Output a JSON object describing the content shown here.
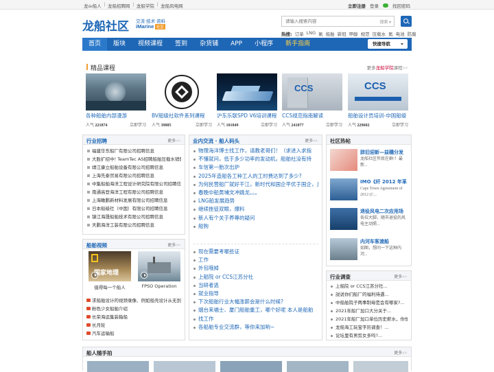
{
  "topbar": {
    "links": [
      "龙de船人",
      "龙船招聘网",
      "龙船学院",
      "龙船风电网"
    ],
    "login_register": "立即注册",
    "login": "登录",
    "find_password": "找回密码"
  },
  "logo": {
    "cn": "龙船社区",
    "tagline": "交流·技术·资料",
    "en": "iMarine",
    "app": "社区"
  },
  "search": {
    "placeholder": "请输入搜索内容",
    "type": "搜索",
    "hot_label": "热搜:",
    "hot": [
      "订单",
      "LNG",
      "氧",
      "船舶",
      "新冠",
      "甲醇",
      "规范",
      "压载水",
      "氮",
      "电池",
      "防腐"
    ]
  },
  "nav": {
    "items": [
      "首页",
      "版块",
      "视频课程",
      "签到",
      "杂货铺",
      "APP",
      "小程序",
      "新手指南"
    ],
    "quick": "快捷导航"
  },
  "courses": {
    "title": "精品课程",
    "more_prefix": "更多",
    "more_link": "龙船学院",
    "more_suffix": "课程>>",
    "pop_label": "人气",
    "learn_label": "立即学习",
    "items": [
      {
        "title": "各种船舶内部漫游",
        "pop": "221874"
      },
      {
        "title": "BV船级社软件系列课程",
        "pop": "39885"
      },
      {
        "title": "沪东乐联SPD V6培训课程",
        "pop": "101849"
      },
      {
        "title": "CCS规范指南解读",
        "pop": "241077"
      },
      {
        "title": "船舶设计员培训-中国船级",
        "pop": "229602"
      }
    ]
  },
  "jobs": {
    "title": "行业招聘",
    "more": "更多>>",
    "items": [
      "福建华东船厂有限公司招聘信息",
      "大胜扩招中! TeamTec AS招聘船舶压载水销售",
      "靖江康立船舶设备有限公司招聘信息",
      "上海先泰贸易有限公司招聘信息",
      "中集船舶海洋工程设计研究院有限公司招聘信息",
      "南通高登海洋工程有限公司招聘信息",
      "上海瞰鹏新材料发展有限公司招聘信息",
      "日本船级社（中国）有限公司招聘信息",
      "镇江海晟船舶技术有限公司招聘信息",
      "天鹏海洋工装有限公司招聘信息"
    ]
  },
  "videos": {
    "title": "船舶视频",
    "more": "更多>>",
    "thumbs": [
      {
        "caption": "值得每一个船人"
      },
      {
        "caption": "FPSO Operation"
      }
    ],
    "thumb_text": "国家地理",
    "items": [
      "求船舶设计的视频录像、例如船壳设计从无到",
      "粉色少女船舶介绍",
      "长荣海运集装箱船",
      "长月轮",
      "汽车运输船"
    ]
  },
  "forum": {
    "title": "业内交流 · 船人码头",
    "more": "更多>>",
    "items_top": [
      "物理海洋博士找工作，请教老哥们！（求进入求指",
      "不懂就问，低于多少功率的发动机，船舶社没有持",
      "车信第一胎次出炉",
      "2025年造船各工种工人的工时费达到了多少?",
      "为何民营船厂就好干江，新时代和国企平优于国企，且",
      "春晚中船黄埔文冲跳龙。。。",
      "LNG船发展趋势",
      "继续挫徒双眼，爆料",
      "新人有个关于养尊的疑问",
      "船狗"
    ],
    "items_bottom": [
      "现在需要考哪些证",
      "工作",
      "外包哦掉",
      "上船院 or CCS江苏分社",
      "当研者逃",
      "就业指导",
      "下次船舶行业大幅涨薪会是什么时候?",
      "烟台来福士、厦门船舶重工，哪个好呢 本人是船舶",
      "找工作",
      "各船舶专业交流群，等你来加哟~"
    ]
  },
  "community": {
    "title": "社区热帖",
    "items": [
      {
        "title": "辞旧迎新—益穗分发",
        "desc": "龙船社区年底在群!！最新..."
      },
      {
        "title": "IMO《纤 2012 年革",
        "desc": "Cape Town Agreement of 2012 (C..."
      },
      {
        "title": "退役风电二次应用场",
        "desc": "各拉大脚，随市退役的风电主动照..."
      },
      {
        "title": "内河车客渡船",
        "desc": "如图，想问一下这种内河..."
      }
    ]
  },
  "survey": {
    "title": "行业调查",
    "more": "更多>>",
    "items": [
      "上船院 or CCS江苏分社...",
      "説说你们船厂的福利待遇...",
      "中船舶院子两事制母是会有哪家?...",
      "2021年船厂加口大分关于...",
      "2021年船厂加口单位历史薪水，你觉...",
      "龙船海工玩宝字历调查！...",
      "论坛里有男剪女多吗?..."
    ]
  },
  "photos": {
    "title": "船人随手拍",
    "more": "更多>>"
  },
  "colors": {
    "brand": "#1e67b6",
    "accent": "#f29b2b",
    "hot_red": "#e04b2b"
  }
}
